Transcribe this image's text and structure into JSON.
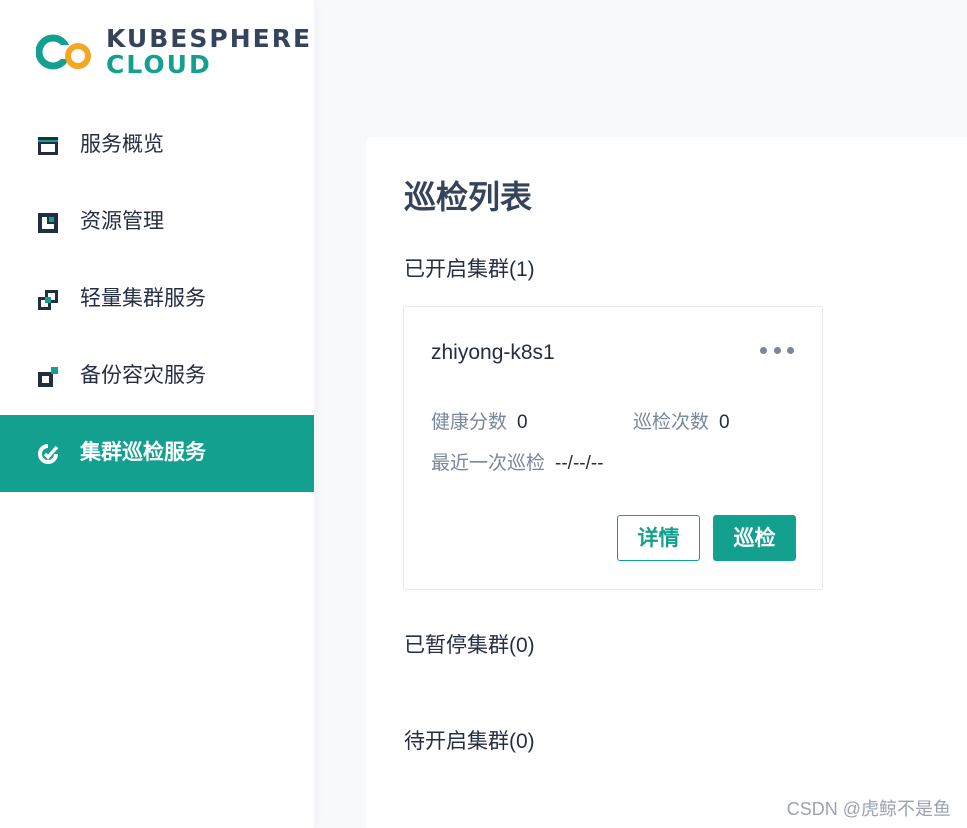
{
  "brand": {
    "line1": "KUBESPHERE",
    "line2": "CLOUD",
    "colors": {
      "primary": "#13a08f",
      "dark": "#36435c",
      "accent": "#f5a623"
    }
  },
  "sidebar": {
    "items": [
      {
        "label": "服务概览",
        "icon": "overview-icon",
        "active": false
      },
      {
        "label": "资源管理",
        "icon": "resource-icon",
        "active": false
      },
      {
        "label": "轻量集群服务",
        "icon": "lightweight-cluster-icon",
        "active": false
      },
      {
        "label": "备份容灾服务",
        "icon": "backup-icon",
        "active": false
      },
      {
        "label": "集群巡检服务",
        "icon": "inspection-icon",
        "active": true
      }
    ]
  },
  "main": {
    "title": "巡检列表",
    "enabled_section": "已开启集群(1)",
    "paused_section": "已暂停集群(0)",
    "pending_section": "待开启集群(0)",
    "cluster": {
      "name": "zhiyong-k8s1",
      "health_label": "健康分数",
      "health_value": "0",
      "count_label": "巡检次数",
      "count_value": "0",
      "last_label": "最近一次巡检",
      "last_value": "--/--/--",
      "detail_button": "详情",
      "inspect_button": "巡检"
    }
  },
  "watermark": "CSDN @虎鲸不是鱼"
}
